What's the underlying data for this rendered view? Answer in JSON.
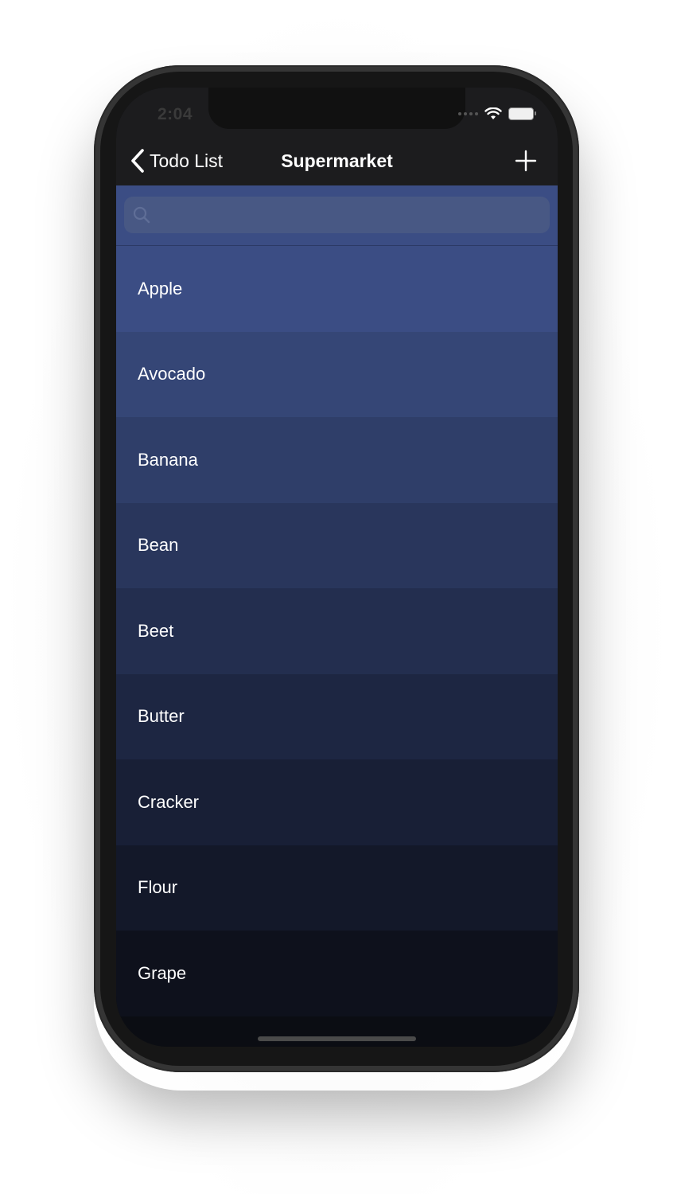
{
  "status_bar": {
    "time": "2:04"
  },
  "nav": {
    "back_label": "Todo List",
    "title": "Supermarket",
    "back_icon": "chevron-left-icon",
    "add_icon": "plus-icon"
  },
  "search": {
    "placeholder": "",
    "icon": "search-icon"
  },
  "items": [
    {
      "label": "Apple",
      "color": "#3b4d84"
    },
    {
      "label": "Avocado",
      "color": "#354676"
    },
    {
      "label": "Banana",
      "color": "#2f3e69"
    },
    {
      "label": "Bean",
      "color": "#29365c"
    },
    {
      "label": "Beet",
      "color": "#232e4f"
    },
    {
      "label": "Butter",
      "color": "#1d2642"
    },
    {
      "label": "Cracker",
      "color": "#181f36"
    },
    {
      "label": "Flour",
      "color": "#131829"
    },
    {
      "label": "Grape",
      "color": "#0e111c"
    }
  ],
  "colors": {
    "nav_background": "#1c1c1e",
    "search_background": "#3b4d84",
    "search_field": "#485884"
  }
}
